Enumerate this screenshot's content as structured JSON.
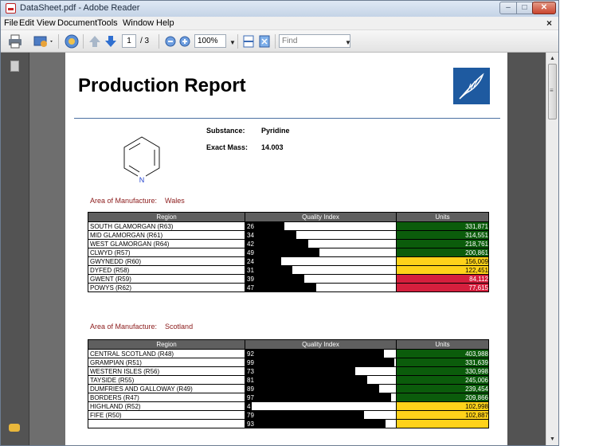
{
  "window": {
    "title": "DataSheet.pdf - Adobe Reader",
    "controls": {
      "minimize": "–",
      "maximize": "□",
      "close": "✕"
    }
  },
  "menu": {
    "items": [
      "File",
      "Edit",
      "View",
      "Document",
      "Tools",
      "Window",
      "Help"
    ],
    "close_doc": "×"
  },
  "toolbar": {
    "page_current": "1",
    "page_total": "/ 3",
    "zoom": "100%",
    "find_placeholder": "Find"
  },
  "report": {
    "title": "Production Report",
    "substance_label": "Substance:",
    "substance_value": "Pyridine",
    "mass_label": "Exact Mass:",
    "mass_value": "14.003",
    "structure_atom": "N",
    "columns": [
      "Region",
      "Quality Index",
      "Units"
    ],
    "area_label": "Area of Manufacture:",
    "sections": [
      {
        "area": "Wales",
        "rows": [
          {
            "region": "SOUTH GLAMORGAN (R63)",
            "quality": 26,
            "units": "331,871",
            "status": "green"
          },
          {
            "region": "MID GLAMORGAN (R61)",
            "quality": 34,
            "units": "314,551",
            "status": "green"
          },
          {
            "region": "WEST GLAMORGAN (R64)",
            "quality": 42,
            "units": "218,761",
            "status": "green"
          },
          {
            "region": "CLWYD (R57)",
            "quality": 49,
            "units": "200,861",
            "status": "green"
          },
          {
            "region": "GWYNEDD (R60)",
            "quality": 24,
            "units": "156,009",
            "status": "yellow"
          },
          {
            "region": "DYFED (R58)",
            "quality": 31,
            "units": "122,451",
            "status": "yellow"
          },
          {
            "region": "GWENT (R59)",
            "quality": 39,
            "units": "84,112",
            "status": "red"
          },
          {
            "region": "POWYS (R62)",
            "quality": 47,
            "units": "77,615",
            "status": "red"
          }
        ]
      },
      {
        "area": "Scotland",
        "rows": [
          {
            "region": "CENTRAL SCOTLAND (R48)",
            "quality": 92,
            "units": "403,988",
            "status": "green"
          },
          {
            "region": "GRAMPIAN (R51)",
            "quality": 99,
            "units": "331,639",
            "status": "green"
          },
          {
            "region": "WESTERN ISLES (R56)",
            "quality": 73,
            "units": "330,998",
            "status": "green"
          },
          {
            "region": "TAYSIDE (R55)",
            "quality": 81,
            "units": "245,006",
            "status": "green"
          },
          {
            "region": "DUMFRIES AND GALLOWAY (R49)",
            "quality": 89,
            "units": "239,454",
            "status": "green"
          },
          {
            "region": "BORDERS (R47)",
            "quality": 97,
            "units": "209,866",
            "status": "green"
          },
          {
            "region": "HIGHLAND (R52)",
            "quality": 4,
            "units": "102,998",
            "status": "yellow"
          },
          {
            "region": "FIFE (R50)",
            "quality": 79,
            "units": "102,887",
            "status": "yellow"
          },
          {
            "region": "",
            "quality": 93,
            "units": "",
            "status": "yellow"
          }
        ]
      }
    ]
  },
  "colors": {
    "green": "#0b5c0b",
    "yellow": "#ffd21a",
    "red": "#d51f3d",
    "header_rule": "#4a6fa1",
    "area_text": "#8b1a1a"
  },
  "icons": {
    "app": "pdf-icon",
    "print": "printer-icon",
    "email": "email-icon",
    "collaborate": "collaborate-icon",
    "prev": "arrow-up-icon",
    "next": "arrow-down-icon",
    "zoom_out": "zoom-out-icon",
    "zoom_in": "zoom-in-icon",
    "fit": "fit-page-icon",
    "fullscreen": "fullscreen-icon",
    "pages": "pages-panel-icon",
    "comments": "comments-icon",
    "logo": "feather-logo"
  }
}
